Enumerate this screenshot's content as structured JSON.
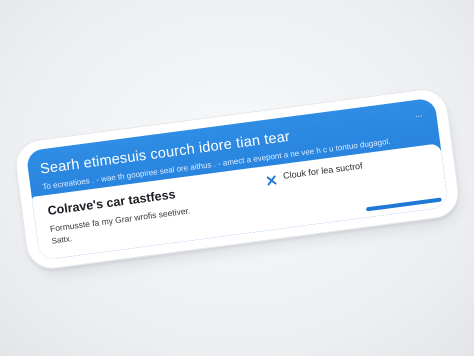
{
  "header": {
    "title": "Searh  etimesuis courch idore tian tear",
    "subtitle": "To ecreatioes . - wae th goopiree seal ore aithus . - amect a evepont a ne vee h c u tontuo dugagol.",
    "more": "..."
  },
  "result": {
    "title": "Colrave's car tastfess",
    "description": "Formusste fa my Grar wrofis seetiver.",
    "meta": "Sattx."
  },
  "action": {
    "icon": "close-icon",
    "label": "Clouk for lea suctrof"
  },
  "colors": {
    "accent": "#1f78d6",
    "background": "#f0f1f3"
  }
}
